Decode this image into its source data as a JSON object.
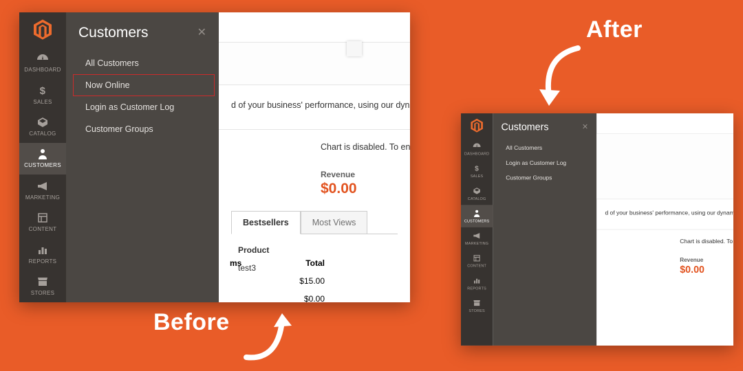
{
  "labels": {
    "before": "Before",
    "after": "After"
  },
  "sidebar": {
    "items": [
      {
        "label": "DASHBOARD",
        "icon": "dashboard-icon"
      },
      {
        "label": "SALES",
        "icon": "dollar-icon"
      },
      {
        "label": "CATALOG",
        "icon": "cube-icon"
      },
      {
        "label": "CUSTOMERS",
        "icon": "person-icon",
        "active": true
      },
      {
        "label": "MARKETING",
        "icon": "megaphone-icon"
      },
      {
        "label": "CONTENT",
        "icon": "blocks-icon"
      },
      {
        "label": "REPORTS",
        "icon": "chart-icon"
      },
      {
        "label": "STORES",
        "icon": "store-icon"
      }
    ]
  },
  "flyout": {
    "title": "Customers",
    "items_before": [
      "All Customers",
      "Now Online",
      "Login as Customer Log",
      "Customer Groups"
    ],
    "items_after": [
      "All Customers",
      "Login as Customer Log",
      "Customer Groups"
    ],
    "highlight_index": 1
  },
  "dashboard": {
    "hint_text": "d of your business' performance, using our dynamic prod",
    "hint_text_after": "d of your business' performance, using our dynam",
    "chart_disabled": "Chart is disabled. To enable ",
    "chart_disabled_after": "Chart is disabled. To e",
    "revenue_label": "Revenue",
    "revenue_value": "$0.00",
    "tabs": [
      {
        "label": "Bestsellers",
        "active": true
      },
      {
        "label": "Most Views"
      }
    ],
    "product_header": "Product",
    "products": [
      "test3"
    ],
    "totals": {
      "qty_header": "ms",
      "total_header": "Total",
      "rows": [
        "$15.00",
        "$0.00"
      ]
    }
  }
}
